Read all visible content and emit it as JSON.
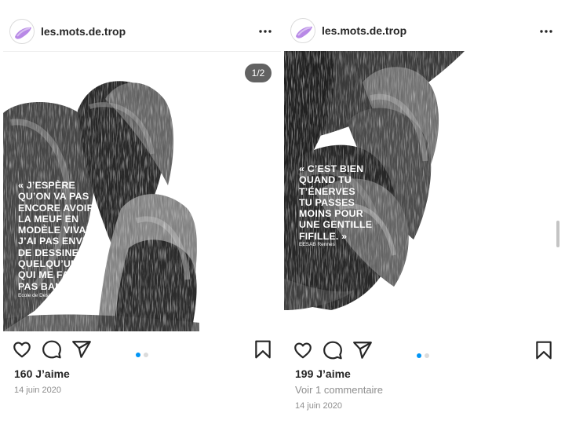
{
  "colors": {
    "accent": "#0095f6",
    "muted": "#8e8e8e",
    "text": "#262626",
    "avatar": "#b889e6"
  },
  "posts": [
    {
      "username": "les.mots.de.trop",
      "counter": "1/2",
      "quote": "« J’ESPÈRE\nQU’ON VA PAS\nENCORE AVOIR\nLA MEUF EN\nMODÈLE VIVANT,\nJ’AI PAS ENVIE\nDE DESSINER\nQUELQU’UN\nQUI ME FAIT\nPAS BANDER. »",
      "credit": "Ecole de Design Nantes",
      "carousel": {
        "active_index": 0,
        "count": 2
      },
      "likes": "160 J’aime",
      "date": "14 juin 2020"
    },
    {
      "username": "les.mots.de.trop",
      "quote": "« C’EST BIEN\nQUAND TU\nT’ÉNERVES\nTU PASSES\nMOINS POUR\nUNE GENTILLE\nFIFILLE. »",
      "credit": "EESAB Rennes",
      "carousel": {
        "active_index": 0,
        "count": 2
      },
      "likes": "199 J’aime",
      "comments": "Voir 1 commentaire",
      "date": "14 juin 2020"
    }
  ],
  "icons": {
    "more": "more-horizontal-icon",
    "like": "heart-icon",
    "comment": "comment-icon",
    "share": "send-icon",
    "save": "bookmark-icon"
  }
}
